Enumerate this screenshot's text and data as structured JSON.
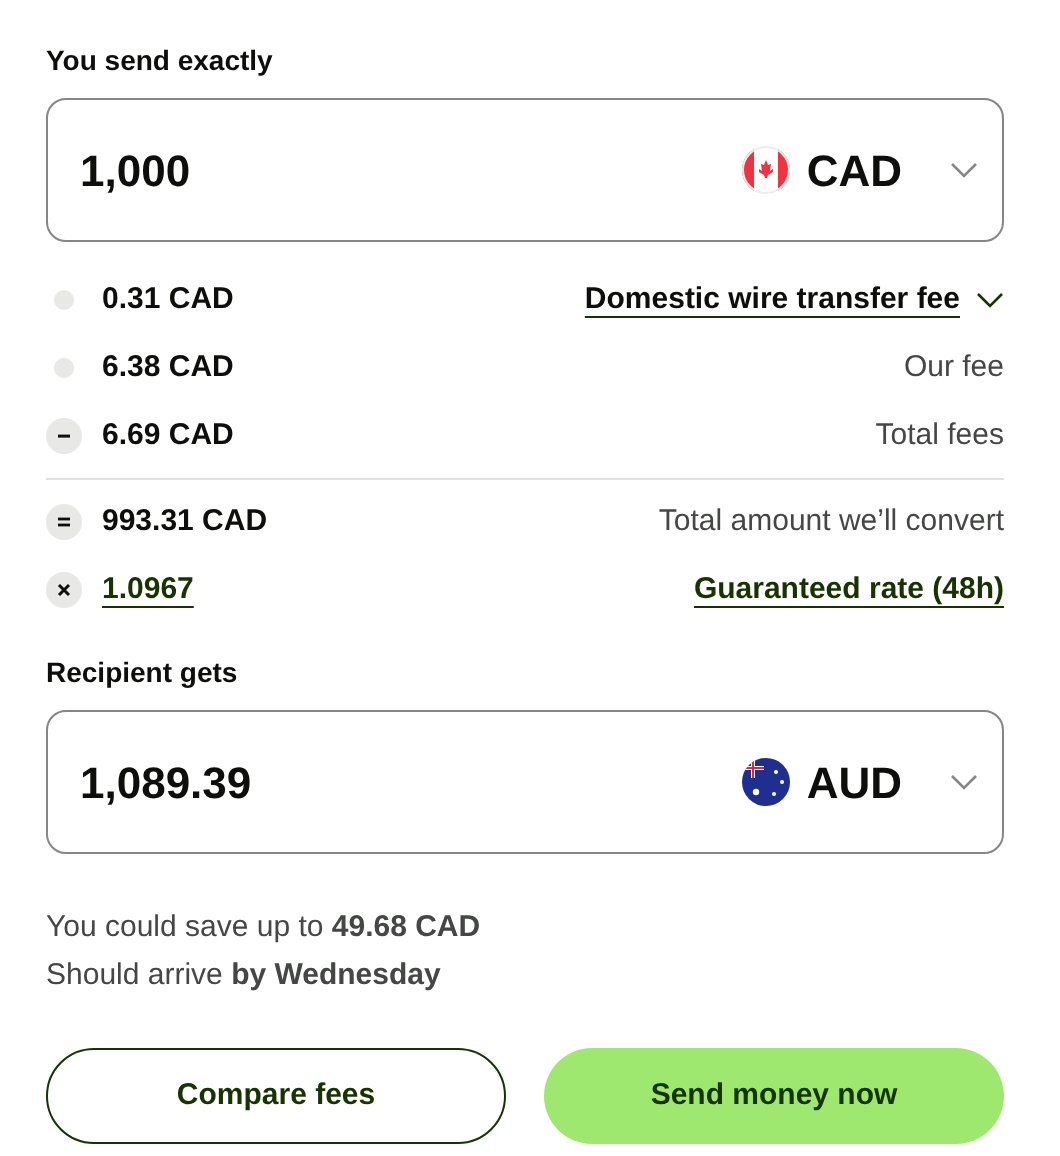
{
  "send": {
    "label": "You send exactly",
    "amount": "1,000",
    "currency": "CAD"
  },
  "fees": [
    {
      "kind": "fee_option",
      "value": "0.31 CAD",
      "label": "Domestic wire transfer fee"
    },
    {
      "kind": "fee",
      "value": "6.38 CAD",
      "label": "Our fee"
    },
    {
      "kind": "total_fees",
      "value": "6.69 CAD",
      "label": "Total fees"
    },
    {
      "kind": "converted",
      "value": "993.31 CAD",
      "label": "Total amount we’ll convert"
    },
    {
      "kind": "rate",
      "value": "1.0967",
      "label": "Guaranteed rate (48h)"
    }
  ],
  "receive": {
    "label": "Recipient gets",
    "amount": "1,089.39",
    "currency": "AUD"
  },
  "notes": [
    "You could save up to **49.68 CAD**",
    "Should arrive **by Wednesday**"
  ],
  "buttons": [
    {
      "label": "Compare fees",
      "kind": "secondary"
    },
    {
      "label": "Send money now",
      "kind": "primary"
    }
  ]
}
